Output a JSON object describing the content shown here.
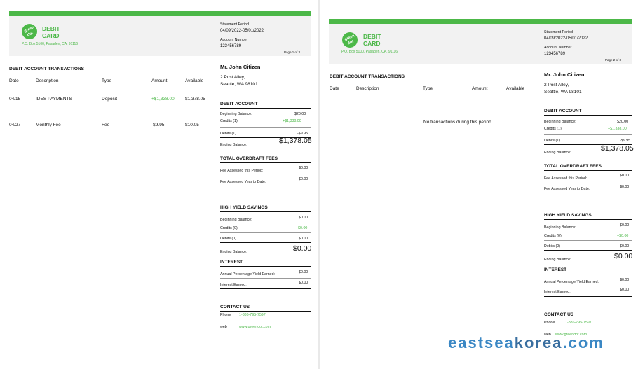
{
  "statement": {
    "brand_logo_line1": "green",
    "brand_logo_line2": "dot",
    "card_line1": "DEBIT",
    "card_line2": "CARD",
    "address": "P.O. Box 5100, Pasaden, CA, 91116",
    "period_label": "Statement Period",
    "period_value": "04/09/2022-05/01/2022",
    "account_label": "Account Number",
    "account_value": "123456789",
    "customer_name": "Mr. John Citizen",
    "customer_addr1": "2 Post Alley,",
    "customer_addr2": "Seattle, WA 98101",
    "transactions_title": "DEBIT ACCOUNT TRANSACTIONS",
    "col_date": "Date",
    "col_description": "Description",
    "col_type": "Type",
    "col_amount": "Amount",
    "col_available": "Available",
    "debit_account": {
      "title": "DEBIT ACCOUNT",
      "beginning_label": "Beginning Balance:",
      "beginning_value": "$20.00",
      "credits_label": "Credits (1)",
      "credits_value": "+$1,338.00",
      "debits_label": "Debits (1)",
      "debits_value": "-$9.95",
      "ending_label": "Ending Balance:",
      "ending_value": "$1,378.05"
    },
    "overdraft": {
      "title": "TOTAL OVERDRAFT FEES",
      "period_label": "Fee Assessed this Period:",
      "period_value": "$0.00",
      "ytd_label": "Fee Assessed Year to Date:",
      "ytd_value": "$0.00"
    },
    "savings": {
      "title": "HIGH YIELD SAVINGS",
      "beginning_label": "Beginning Balance:",
      "beginning_value": "$0.00",
      "credits_label": "Credits (0)",
      "credits_value": "+$0.00",
      "debits_label": "Debits (0)",
      "debits_value": "$0.00",
      "ending_label": "Ending Balance:",
      "ending_value": "$0.00"
    },
    "interest": {
      "title": "INTEREST",
      "apy_label": "Annual Percentage Yield Earned:",
      "apy_value": "$0.00",
      "earned_label": "Interest Earned:",
      "earned_value": "$0.00"
    },
    "contact": {
      "title": "CONTACT US",
      "phone_label": "Phone",
      "phone_value": "1-886-795-7597",
      "web_label": "web",
      "web_value": "www.greendot.com"
    }
  },
  "page1": {
    "page_label": "Page 1 of 3",
    "transactions": [
      {
        "date": "04/15",
        "description": "IDES PAYMENTS",
        "type": "Deposit",
        "amount": "+$1,338.00",
        "available": "$1,378.05"
      },
      {
        "date": "04/27",
        "description": "Monthly Fee",
        "type": "Fee",
        "amount": "-$9.95",
        "available": "$10.05"
      }
    ]
  },
  "page2": {
    "page_label": "Page 2 of 3",
    "no_transactions": "No transactions during this period"
  },
  "watermark": {
    "part1": "eastsea",
    "part2": "korea",
    "part3": ".com"
  },
  "colors": {
    "brand_green": "#4cb848",
    "watermark_blue": "#3a87c4"
  }
}
